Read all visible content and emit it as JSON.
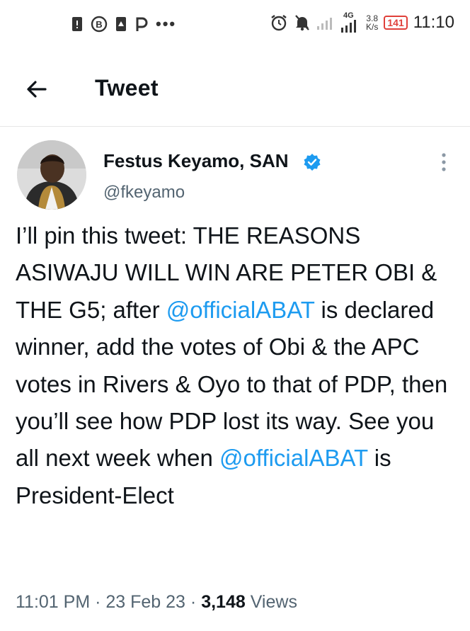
{
  "status_bar": {
    "left_icons": [
      "sim-card-icon",
      "b-circle-icon",
      "download-notice-icon",
      "p-app-icon"
    ],
    "more_dots": "•••",
    "network_label": "4G",
    "speed_value": "3.8",
    "speed_unit": "K/s",
    "battery": "141",
    "time": "11:10"
  },
  "header": {
    "title": "Tweet"
  },
  "tweet": {
    "author_name": "Festus Keyamo, SAN",
    "handle": "@fkeyamo",
    "text_1": "I’ll pin this tweet: THE REASONS ASIWAJU WILL WIN ARE PETER OBI & THE G5; after ",
    "mention_1": "@officialABAT",
    "text_2": " is declared winner, add the votes of Obi & the APC votes in Rivers & Oyo to that of PDP, then you’ll see how PDP lost its way. See you all next week when ",
    "mention_2": "@officialABAT",
    "text_3": " is President-Elect",
    "time": "11:01 PM",
    "date": "23 Feb 23",
    "sep": " · ",
    "views_count": "3,148",
    "views_label": "Views"
  },
  "colors": {
    "accent": "#1d9bf0",
    "secondary_text": "#536471",
    "battery": "#e0403a"
  }
}
